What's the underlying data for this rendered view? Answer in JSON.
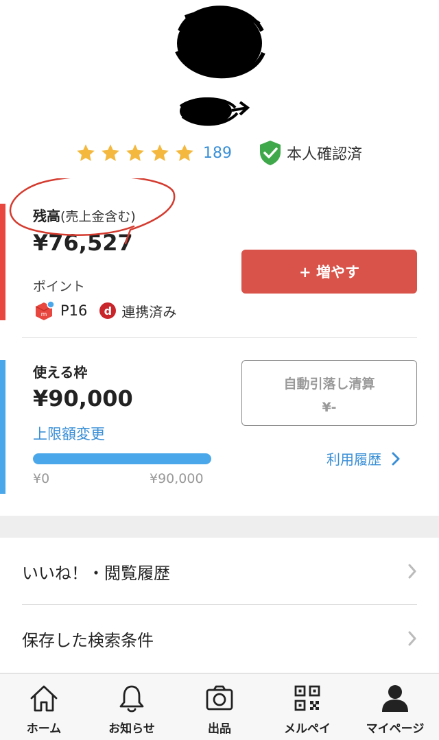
{
  "profile": {
    "rating_stars": 5,
    "rating_count": "189",
    "verified_label": "本人確認済"
  },
  "balance": {
    "title": "残高",
    "title_sub": "(売上金含む)",
    "amount": "¥76,527",
    "increase_button": "+ 増やす",
    "points_title": "ポイント",
    "points_value": "P16",
    "dpoint_icon_text": "d",
    "dpoint_label": "連携済み"
  },
  "credit": {
    "title": "使える枠",
    "amount": "¥90,000",
    "limit_link": "上限額変更",
    "progress_fraction": 1.0,
    "progress_min": "¥0",
    "progress_max": "¥90,000",
    "auto_settle_title": "自動引落し清算",
    "auto_settle_value": "¥-",
    "history_link": "利用履歴"
  },
  "menu": {
    "items": [
      {
        "label": "いいね！・閲覧履歴"
      },
      {
        "label": "保存した検索条件"
      }
    ]
  },
  "nav": {
    "items": [
      {
        "label": "ホーム",
        "icon": "home-icon"
      },
      {
        "label": "お知らせ",
        "icon": "bell-icon"
      },
      {
        "label": "出品",
        "icon": "camera-icon"
      },
      {
        "label": "メルペイ",
        "icon": "qr-code-icon"
      },
      {
        "label": "マイページ",
        "icon": "person-icon"
      }
    ]
  },
  "colors": {
    "accent_red": "#d9534a",
    "link_blue": "#3a8fd6",
    "star_yellow": "#f3b83d",
    "verified_green": "#3fa84a",
    "progress_blue": "#4aa8ea"
  }
}
